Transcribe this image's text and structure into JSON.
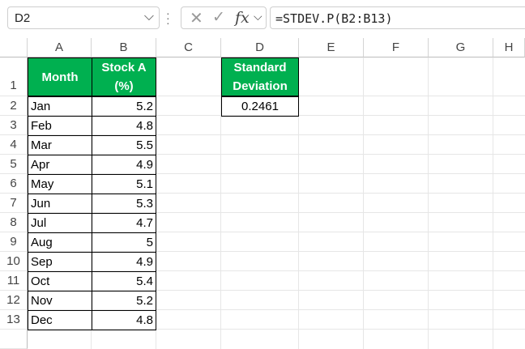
{
  "formula_bar": {
    "name_box": "D2",
    "formula": "=STDEV.P(B2:B13)",
    "cancel_symbol": "✕",
    "enter_symbol": "✓",
    "fx_label": "fx"
  },
  "columns": [
    "A",
    "B",
    "C",
    "D",
    "E",
    "F",
    "G",
    "H"
  ],
  "rows": [
    "1",
    "2",
    "3",
    "4",
    "5",
    "6",
    "7",
    "8",
    "9",
    "10",
    "11",
    "12",
    "13",
    ""
  ],
  "table": {
    "header_month": "Month",
    "header_stock_line1": "Stock A",
    "header_stock_line2": "(%)",
    "data": [
      {
        "month": "Jan",
        "value": "5.2"
      },
      {
        "month": "Feb",
        "value": "4.8"
      },
      {
        "month": "Mar",
        "value": "5.5"
      },
      {
        "month": "Apr",
        "value": "4.9"
      },
      {
        "month": "May",
        "value": "5.1"
      },
      {
        "month": "Jun",
        "value": "5.3"
      },
      {
        "month": "Jul",
        "value": "4.7"
      },
      {
        "month": "Aug",
        "value": "5"
      },
      {
        "month": "Sep",
        "value": "4.9"
      },
      {
        "month": "Oct",
        "value": "5.4"
      },
      {
        "month": "Nov",
        "value": "5.2"
      },
      {
        "month": "Dec",
        "value": "4.8"
      }
    ]
  },
  "result": {
    "header_line1": "Standard",
    "header_line2": "Deviation",
    "value": "0.2461"
  },
  "colors": {
    "header_fill": "#00b050",
    "header_text": "#ffffff"
  }
}
